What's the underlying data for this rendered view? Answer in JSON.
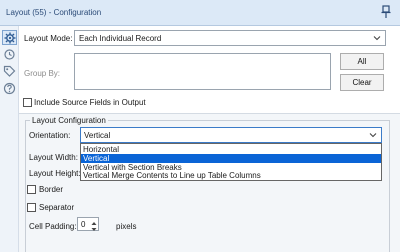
{
  "window": {
    "title": "Layout (55) - Configuration",
    "pin_icon": "pin-icon"
  },
  "sidebar": {
    "icons": [
      "gear-icon",
      "refresh-icon",
      "tag-icon",
      "help-icon"
    ]
  },
  "layout_mode": {
    "label": "Layout Mode:",
    "value": "Each Individual Record"
  },
  "group_by": {
    "label": "Group By:",
    "all_button": "All",
    "clear_button": "Clear"
  },
  "include_source": {
    "label": "Include Source Fields in Output",
    "checked": false
  },
  "layout_config": {
    "title": "Layout Configuration",
    "orientation_label": "Orientation:",
    "orientation_value": "Vertical",
    "orientation_options": [
      "Horizontal",
      "Vertical",
      "Vertical with Section Breaks",
      "Vertical Merge Contents to Line up Table Columns"
    ],
    "selected_option_index": 1,
    "width_label": "Layout Width:",
    "height_label": "Layout Height:",
    "border_label": "Border",
    "border_checked": false,
    "separator_label": "Separator",
    "separator_checked": false,
    "padding_label": "Cell Padding:",
    "padding_value": "0",
    "padding_unit": "pixels"
  },
  "colors": {
    "titlebar_bg": "#dce9f7",
    "selection": "#0a64d6",
    "focus_border": "#3b7bc8"
  }
}
